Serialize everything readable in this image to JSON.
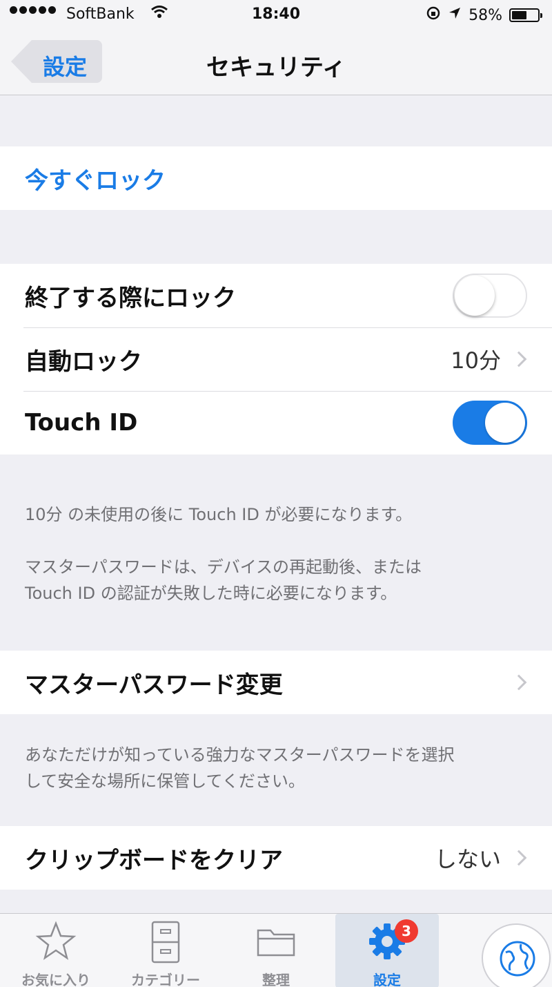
{
  "status_bar": {
    "carrier": "SoftBank",
    "time": "18:40",
    "battery": "58%",
    "battery_level": 0.58,
    "icons": [
      "signal-dots-icon",
      "wifi-icon",
      "orientation-lock-icon",
      "location-arrow-icon",
      "battery-icon"
    ]
  },
  "nav": {
    "back_label": "設定",
    "title": "セキュリティ"
  },
  "lock_now": {
    "label": "今すぐロック"
  },
  "security_settings": {
    "lock_on_exit": {
      "label": "終了する際にロック",
      "on": false
    },
    "auto_lock": {
      "label": "自動ロック",
      "value": "10分"
    },
    "touch_id": {
      "label": "Touch ID",
      "on": true
    }
  },
  "notes": {
    "touch_id_note": "10分 の未使用の後に Touch ID が必要になります。",
    "master_password_note_1": "マスターパスワードは、デバイスの再起動後、または",
    "master_password_note_2": "Touch ID の認証が失敗した時に必要になります。"
  },
  "master_password": {
    "label": "マスターパスワード変更"
  },
  "master_password_hint": {
    "line_1": "あなただけが知っている強力なマスターパスワードを選択",
    "line_2": "して安全な場所に保管してください。"
  },
  "clipboard": {
    "label": "クリップボードをクリア",
    "value": "しない"
  },
  "tab_bar": {
    "favorites": "お気に入り",
    "categories": "カテゴリー",
    "organize": "整理",
    "settings": "設定",
    "settings_badge": "3"
  },
  "colors": {
    "accent": "#1a7ce6",
    "background": "#efeff4",
    "badge": "#f03a30"
  }
}
